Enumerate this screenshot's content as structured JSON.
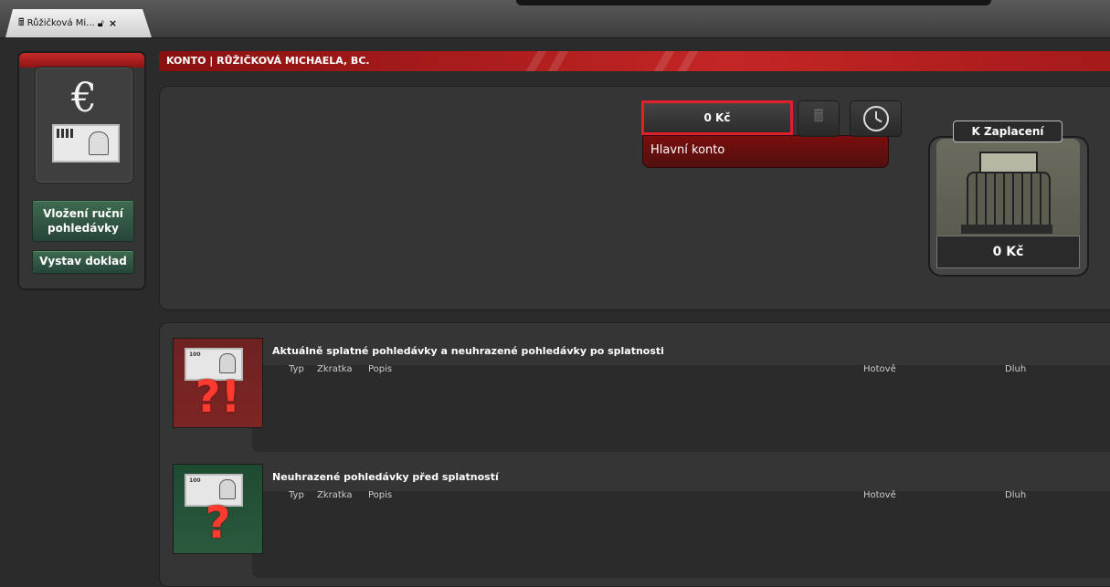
{
  "tab": {
    "title": "Růžičková Mi...",
    "icon": "cash-register-icon",
    "lock_icon": "lock-icon",
    "close": "×"
  },
  "sidebar": {
    "icon": "euro-banknote-icon",
    "buttons": [
      {
        "label": "Vložení ruční pohledávky"
      },
      {
        "label": "Vystav doklad"
      }
    ]
  },
  "header": {
    "title": "KONTO | RŮŽIČKOVÁ MICHAELA, BC."
  },
  "account": {
    "amount": "0 Kč",
    "selected_account": "Hlavní konto",
    "register_button_icon": "cash-register-icon",
    "history_button_icon": "clock-icon"
  },
  "payment": {
    "title": "K Zaplacení",
    "amount": "0 Kč"
  },
  "sections": [
    {
      "title": "Aktuálně splatné pohledávky a neuhrazené pohledávky po splatnosti",
      "icon_mark": "?!",
      "bill_label": "100",
      "columns": [
        "Typ",
        "Zkratka",
        "Popis",
        "Hotově",
        "Dluh"
      ]
    },
    {
      "title": "Neuhrazené pohledávky před splatností",
      "icon_mark": "?",
      "bill_label": "100",
      "columns": [
        "Typ",
        "Zkratka",
        "Popis",
        "Hotově",
        "Dluh"
      ]
    }
  ],
  "colors": {
    "accent_red": "#c42626",
    "highlight_border": "#e0202a",
    "button_green": "#3e6a4f"
  }
}
